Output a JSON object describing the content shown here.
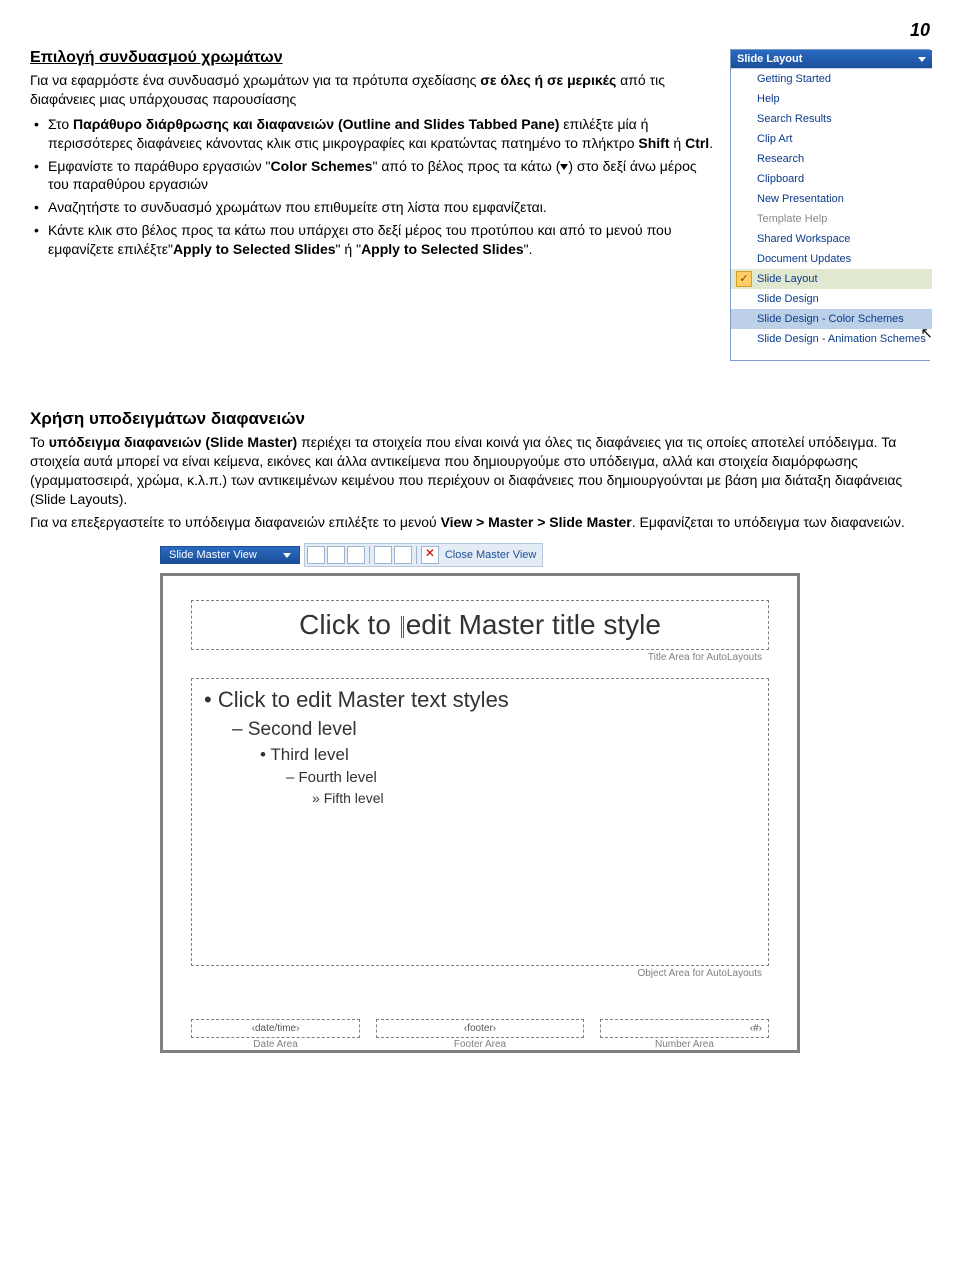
{
  "page_number": "10",
  "section1": {
    "title": "Επιλογή συνδυασμού χρωμάτων",
    "intro_pre": "Για να εφαρμόστε ένα συνδυασμό χρωμάτων για τα πρότυπα σχεδίασης ",
    "intro_bold1": "σε όλες ή σε μερικές",
    "intro_post": " από τις διαφάνειες μιας υπάρχουσας παρουσίασης",
    "b1_pre": "Στο ",
    "b1_bold": "Παράθυρο διάρθρωσης και διαφανειών (Outline and Slides Tabbed Pane)",
    "b1_mid": " επιλέξτε μία ή περισσότερες διαφάνειες κάνοντας κλικ στις μικρογραφίες και κρατώντας πατημένο το πλήκτρο ",
    "b1_k1": "Shift",
    "b1_or": " ή ",
    "b1_k2": "Ctrl",
    "b1_end": ".",
    "b2_pre": "Εμφανίστε το παράθυρο εργασιών \"",
    "b2_bold": "Color Schemes",
    "b2_mid": "\" από το βέλος προς τα κάτω (",
    "b2_post": ") στο δεξί άνω μέρος του παραθύρου εργασιών",
    "b3": "Αναζητήστε το συνδυασμό χρωμάτων που επιθυμείτε στη λίστα που εμφανίζεται.",
    "b4_pre": "Κάντε κλικ στο βέλος προς τα κάτω που υπάρχει στο δεξί μέρος του προτύπου και από το μενού που εμφανίζετε επιλέξτε\"",
    "b4_bold1": "Apply to Selected Slides",
    "b4_mid": "\" ή \"",
    "b4_bold2": "Apply to Selected Slides",
    "b4_end": "\"."
  },
  "taskpane": {
    "title": "Slide Layout",
    "items": [
      {
        "label": "Getting Started"
      },
      {
        "label": "Help"
      },
      {
        "label": "Search Results"
      },
      {
        "label": "Clip Art"
      },
      {
        "label": "Research"
      },
      {
        "label": "Clipboard"
      },
      {
        "label": "New Presentation"
      },
      {
        "label": "Template Help",
        "muted": true
      },
      {
        "label": "Shared Workspace"
      },
      {
        "label": "Document Updates"
      },
      {
        "label": "Slide Layout",
        "checked": true,
        "selected": true
      },
      {
        "label": "Slide Design"
      },
      {
        "label": "Slide Design - Color Schemes",
        "highlight": true
      },
      {
        "label": "Slide Design - Animation Schemes"
      }
    ]
  },
  "section2": {
    "title": "Χρήση υποδειγμάτων διαφανειών",
    "p1_pre": "Το ",
    "p1_bold": "υπόδειγμα διαφανειών (Slide Master)",
    "p1_post": " περιέχει τα στοιχεία που είναι κοινά για όλες τις διαφάνειες για τις οποίες αποτελεί υπόδειγμα. Τα στοιχεία αυτά μπορεί να είναι κείμενα, εικόνες και άλλα αντικείμενα που δημιουργούμε στο υπόδειγμα, αλλά και στοιχεία διαμόρφωσης (γραμματοσειρά, χρώμα, κ.λ.π.) των αντικειμένων κειμένου που περιέχουν οι διαφάνειες που δημιουργούνται με βάση μια διάταξη διαφάνειας (Slide Layouts).",
    "p2_pre": "Για να επεξεργαστείτε το υπόδειγμα διαφανειών επιλέξτε το μενού ",
    "p2_bold": "View > Master > Slide Master",
    "p2_post": ". Εμφανίζεται το υπόδειγμα των διαφανειών."
  },
  "master": {
    "toolbar_title": "Slide Master View",
    "close_label": "Close Master View",
    "title_text": "Click to edit Master title style",
    "title_area": "Title Area for AutoLayouts",
    "l1": "Click to edit Master text styles",
    "l2": "Second level",
    "l3": "Third level",
    "l4": "Fourth level",
    "l5": "Fifth level",
    "object_area": "Object Area for AutoLayouts",
    "date_ph": "‹date/time›",
    "date_lbl": "Date Area",
    "footer_ph": "‹footer›",
    "footer_lbl": "Footer Area",
    "num_ph": "‹#›",
    "num_lbl": "Number Area"
  }
}
